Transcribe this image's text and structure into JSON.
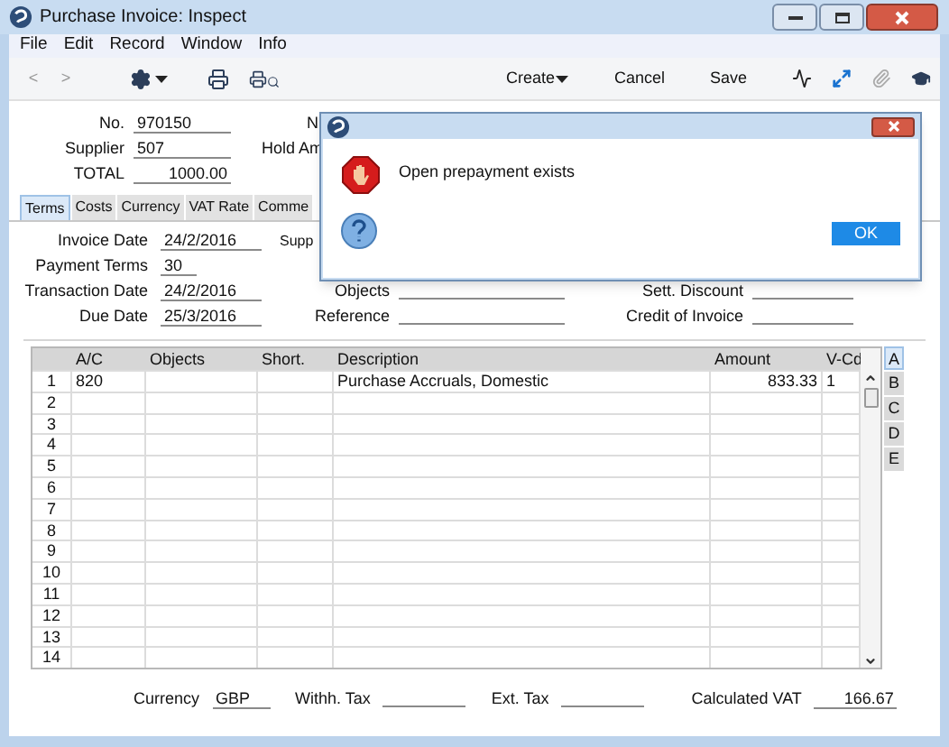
{
  "window": {
    "title": "Purchase Invoice: Inspect"
  },
  "menu": [
    "File",
    "Edit",
    "Record",
    "Window",
    "Info"
  ],
  "toolbar": {
    "nav": [
      {
        "label": "<",
        "disabled": true
      },
      {
        "label": ">",
        "disabled": true
      }
    ],
    "actions": [
      {
        "label": "Create",
        "dropdown": true
      },
      {
        "label": "Cancel",
        "dropdown": false
      },
      {
        "label": "Save",
        "dropdown": false
      }
    ],
    "attach_disabled": true
  },
  "header_fields": [
    {
      "label": "No.",
      "value": "970150",
      "aside": "N"
    },
    {
      "label": "Supplier",
      "value": "507",
      "aside": "Hold Am"
    },
    {
      "label": "TOTAL",
      "value": "1000.00"
    }
  ],
  "tabs": [
    {
      "label": "Terms",
      "selected": true
    },
    {
      "label": "Costs",
      "selected": false
    },
    {
      "label": "Currency",
      "selected": false
    },
    {
      "label": "VAT Rate",
      "selected": false
    },
    {
      "label": "Comme",
      "selected": false
    }
  ],
  "terms_rows": [
    {
      "left": {
        "label": "Invoice Date",
        "value": "24/2/2016"
      },
      "middle": {
        "label": "Supp"
      }
    },
    {
      "left": {
        "label": "Payment Terms",
        "value": "30"
      }
    },
    {
      "left": {
        "label": "Transaction Date",
        "value": "24/2/2016"
      },
      "middle": {
        "label": "Objects"
      },
      "right": {
        "label": "Sett. Discount"
      }
    },
    {
      "left": {
        "label": "Due Date",
        "value": "25/3/2016"
      },
      "middle": {
        "label": "Reference"
      },
      "right": {
        "label": "Credit of Invoice"
      }
    }
  ],
  "table": {
    "columns": [
      "A/C",
      "Objects",
      "Short.",
      "Description",
      "Amount",
      "V-Cd"
    ],
    "rows": [
      {
        "number": "1",
        "ac": "820",
        "description": "Purchase Accruals, Domestic",
        "amount": "833.33",
        "vcd": "1"
      },
      {
        "number": "2"
      },
      {
        "number": "3"
      },
      {
        "number": "4"
      },
      {
        "number": "5"
      },
      {
        "number": "6"
      },
      {
        "number": "7"
      },
      {
        "number": "8"
      },
      {
        "number": "9"
      },
      {
        "number": "10"
      },
      {
        "number": "11"
      },
      {
        "number": "12"
      },
      {
        "number": "13"
      },
      {
        "number": "14"
      }
    ],
    "side_tabs": [
      {
        "label": "A",
        "selected": true
      },
      {
        "label": "B",
        "selected": false
      },
      {
        "label": "C",
        "selected": false
      },
      {
        "label": "D",
        "selected": false
      },
      {
        "label": "E",
        "selected": false
      }
    ]
  },
  "footer_fields": [
    {
      "label": "Currency",
      "value": "GBP"
    },
    {
      "label": "Withh. Tax"
    },
    {
      "label": "Ext. Tax"
    },
    {
      "label": "Calculated VAT",
      "value": "166.67"
    }
  ],
  "dialog": {
    "message": "Open prepayment exists",
    "button": "OK"
  }
}
